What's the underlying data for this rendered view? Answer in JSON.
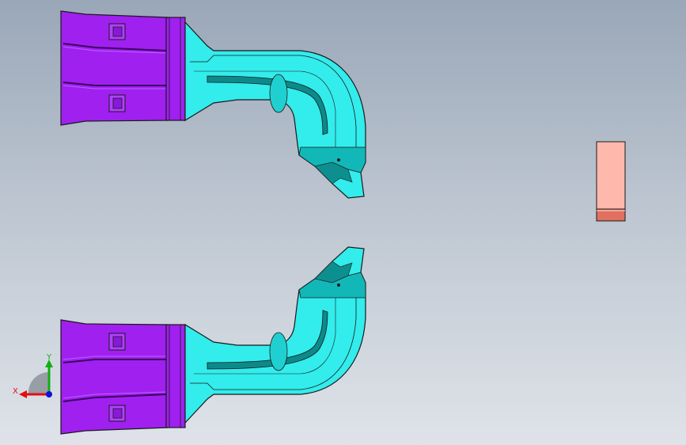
{
  "viewport": {
    "colors": {
      "housing": "#a020f0",
      "housing_dark": "#7a10c0",
      "body": "#33ecec",
      "body_dark": "#12b8b8",
      "block": "#ffb8ac",
      "block_edge": "#e07060",
      "outline": "#1a1a1a"
    },
    "parts": [
      {
        "name": "upper-part",
        "color": "body"
      },
      {
        "name": "lower-part",
        "color": "body"
      },
      {
        "name": "insert-block",
        "color": "block"
      }
    ]
  },
  "triad": {
    "x_label": "X",
    "y_label": "Y",
    "x_color": "#e01010",
    "y_color": "#10b010",
    "z_color": "#1010e0"
  }
}
